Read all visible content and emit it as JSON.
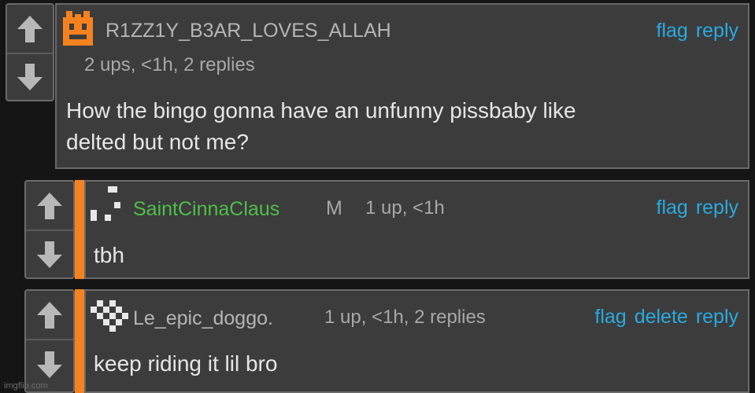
{
  "comments": [
    {
      "username": "R1ZZ1Y_B3AR_LOVES_ALLAH",
      "meta": "2 ups, <1h, 2 replies",
      "body_line1": "How the bingo gonna have an unfunny pissbaby like",
      "body_line2": "delted but not me?",
      "actions": [
        "flag",
        "reply"
      ]
    },
    {
      "username": "SaintCinnaClaus",
      "badge": "M",
      "meta": "1 up, <1h",
      "body": "tbh",
      "actions": [
        "flag",
        "reply"
      ]
    },
    {
      "username": "Le_epic_doggo.",
      "meta": "1 up, <1h, 2 replies",
      "body": "keep riding it lil bro",
      "actions": [
        "flag",
        "delete",
        "reply"
      ]
    }
  ],
  "watermark": "imgflip.com",
  "colors": {
    "background": "#151515",
    "card": "#3c3c3c",
    "border": "#6a6a6a",
    "link": "#2aa9e0",
    "accent_orange": "#f5821f",
    "username_green": "#4fbf4a",
    "meta": "#a8a8a8"
  }
}
